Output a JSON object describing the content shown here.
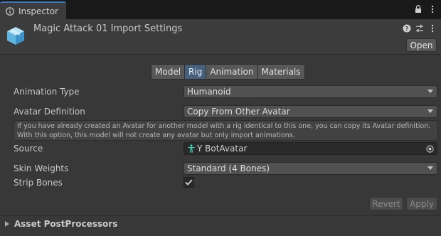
{
  "tab": {
    "title": "Inspector",
    "icon": "info-icon"
  },
  "tabbar_icons": [
    "lock-icon",
    "kebab-menu-icon"
  ],
  "header": {
    "title": "Magic Attack 01 Import Settings",
    "icon": "cube-asset-icon",
    "icons": [
      "help-icon",
      "preset-sliders-icon",
      "kebab-menu-icon"
    ],
    "open_label": "Open"
  },
  "toolbar": {
    "tabs": [
      {
        "label": "Model",
        "active": false
      },
      {
        "label": "Rig",
        "active": true
      },
      {
        "label": "Animation",
        "active": false
      },
      {
        "label": "Materials",
        "active": false
      }
    ]
  },
  "fields": {
    "animation_type": {
      "label": "Animation Type",
      "value": "Humanoid"
    },
    "avatar_definition": {
      "label": "Avatar Definition",
      "value": "Copy From Other Avatar"
    },
    "help_text_line1": "If you have already created an Avatar for another model with a rig identical to this one, you can copy its Avatar definition.",
    "help_text_line2": "With this option, this model will not create any avatar but only import animations.",
    "source": {
      "label": "Source",
      "value": "Y BotAvatar",
      "icon": "humanoid-avatar-icon",
      "picker_icon": "object-picker-icon"
    },
    "skin_weights": {
      "label": "Skin Weights",
      "value": "Standard (4 Bones)"
    },
    "strip_bones": {
      "label": "Strip Bones",
      "checked": true
    }
  },
  "actions": {
    "revert_label": "Revert",
    "apply_label": "Apply"
  },
  "foldout": {
    "label": "Asset PostProcessors",
    "expanded": false
  },
  "colors": {
    "accent": "#3a79bb",
    "active_tab": "#46607c",
    "background": "#383838"
  }
}
